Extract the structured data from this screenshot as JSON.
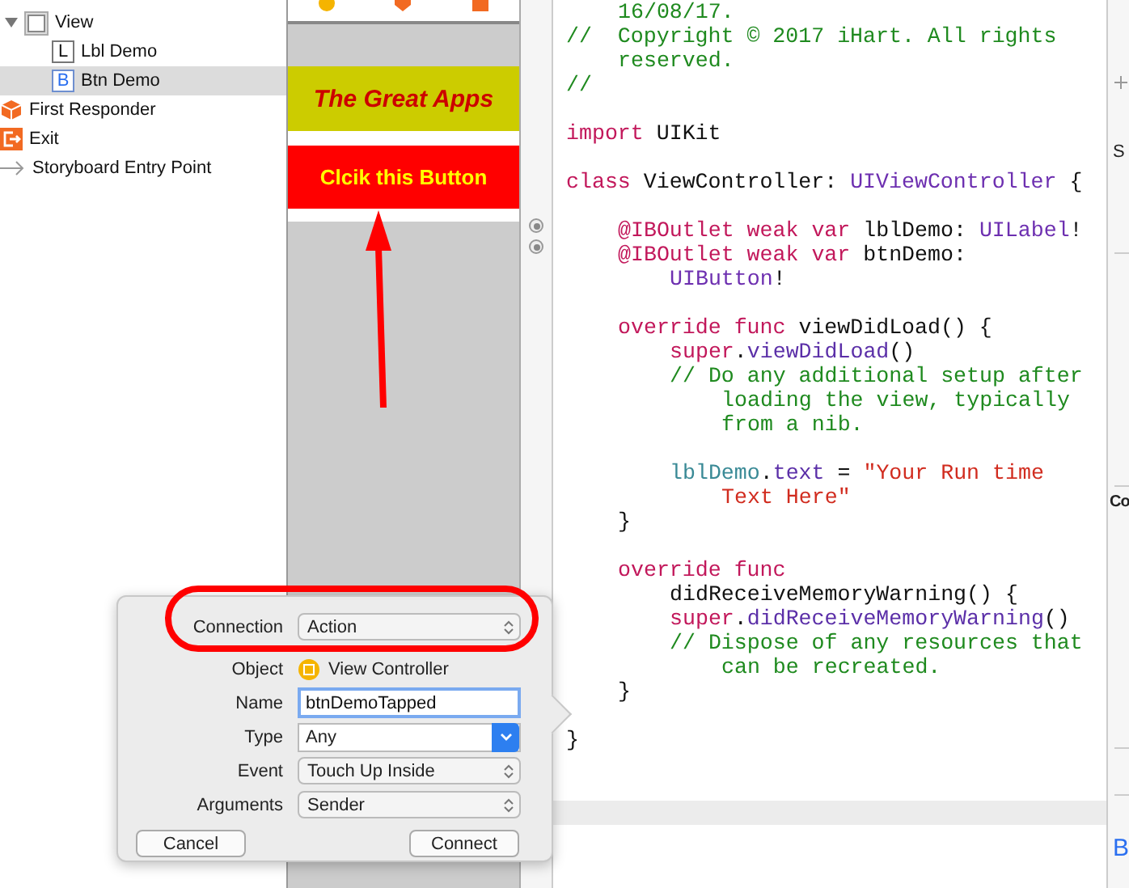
{
  "outline": {
    "items": [
      {
        "label": "View",
        "kind": "view",
        "selected": false,
        "expanded": true,
        "children": [
          {
            "label": "Lbl Demo",
            "kind": "label",
            "badge": "L",
            "selected": false
          },
          {
            "label": "Btn Demo",
            "kind": "button",
            "badge": "B",
            "selected": true
          }
        ]
      },
      {
        "label": "First Responder",
        "kind": "responder",
        "selected": false
      },
      {
        "label": "Exit",
        "kind": "exit",
        "selected": false
      },
      {
        "label": "Storyboard Entry Point",
        "kind": "entry",
        "selected": false
      }
    ]
  },
  "canvas": {
    "title_label": "The Great Apps",
    "button_label": "Clcik this Button"
  },
  "code": {
    "blocks": [
      [
        {
          "kind": "indented",
          "tokens": [
            {
              "kind": "comment",
              "text": "16/08/17."
            }
          ]
        },
        {
          "kind": "flush",
          "tokens": [
            {
              "kind": "comment",
              "text": "//  Copyright © 2017 iHart. All rights"
            }
          ]
        },
        {
          "kind": "indented",
          "tokens": [
            {
              "kind": "comment",
              "text": "reserved."
            }
          ]
        },
        {
          "kind": "flush",
          "tokens": [
            {
              "kind": "comment",
              "text": "//"
            }
          ]
        }
      ],
      [
        {
          "kind": "flush",
          "tokens": [
            {
              "kind": "keyword",
              "text": "import"
            },
            {
              "kind": "plain",
              "text": " UIKit"
            }
          ]
        }
      ],
      [
        {
          "kind": "flush",
          "tokens": [
            {
              "kind": "keyword",
              "text": "class"
            },
            {
              "kind": "plain",
              "text": " ViewController: "
            },
            {
              "kind": "type",
              "text": "UIViewController"
            },
            {
              "kind": "plain",
              "text": " {"
            }
          ]
        }
      ],
      [
        {
          "kind": "indented",
          "tokens": [
            {
              "kind": "keyword",
              "text": "@IBOutlet weak var"
            },
            {
              "kind": "plain",
              "text": " lblDemo: "
            },
            {
              "kind": "type",
              "text": "UILabel"
            },
            {
              "kind": "plain",
              "text": "!"
            }
          ]
        },
        {
          "kind": "indented",
          "tokens": [
            {
              "kind": "keyword",
              "text": "@IBOutlet weak var"
            },
            {
              "kind": "plain",
              "text": " btnDemo:"
            }
          ]
        },
        {
          "kind": "nested",
          "tokens": [
            {
              "kind": "type",
              "text": "UIButton"
            },
            {
              "kind": "plain",
              "text": "!"
            }
          ]
        }
      ],
      [
        {
          "kind": "indented",
          "tokens": [
            {
              "kind": "keyword",
              "text": "override func"
            },
            {
              "kind": "plain",
              "text": " viewDidLoad() {"
            }
          ]
        },
        {
          "kind": "nested",
          "tokens": [
            {
              "kind": "keyword",
              "text": "super"
            },
            {
              "kind": "plain",
              "text": "."
            },
            {
              "kind": "member",
              "text": "viewDidLoad"
            },
            {
              "kind": "plain",
              "text": "()"
            }
          ]
        },
        {
          "kind": "nested",
          "tokens": [
            {
              "kind": "comment",
              "text": "// Do any additional setup after"
            }
          ]
        },
        {
          "kind": "wrapped",
          "tokens": [
            {
              "kind": "comment",
              "text": "loading the view, typically"
            }
          ]
        },
        {
          "kind": "wrapped",
          "tokens": [
            {
              "kind": "comment",
              "text": "from a nib."
            }
          ]
        }
      ],
      [
        {
          "kind": "nested",
          "tokens": [
            {
              "kind": "outlet",
              "text": "lblDemo"
            },
            {
              "kind": "plain",
              "text": "."
            },
            {
              "kind": "member",
              "text": "text"
            },
            {
              "kind": "plain",
              "text": " = "
            },
            {
              "kind": "string",
              "text": "\"Your Run time"
            }
          ]
        },
        {
          "kind": "wrapped",
          "tokens": [
            {
              "kind": "string",
              "text": "Text Here\""
            }
          ]
        },
        {
          "kind": "indented",
          "tokens": [
            {
              "kind": "plain",
              "text": "}"
            }
          ]
        }
      ],
      [
        {
          "kind": "indented",
          "tokens": [
            {
              "kind": "keyword",
              "text": "override func"
            }
          ]
        },
        {
          "kind": "nested",
          "tokens": [
            {
              "kind": "plain",
              "text": "didReceiveMemoryWarning() {"
            }
          ]
        },
        {
          "kind": "nested",
          "tokens": [
            {
              "kind": "keyword",
              "text": "super"
            },
            {
              "kind": "plain",
              "text": "."
            },
            {
              "kind": "member",
              "text": "didReceiveMemoryWarning"
            },
            {
              "kind": "plain",
              "text": "()"
            }
          ]
        },
        {
          "kind": "nested",
          "tokens": [
            {
              "kind": "comment",
              "text": "// Dispose of any resources that"
            }
          ]
        },
        {
          "kind": "wrapped",
          "tokens": [
            {
              "kind": "comment",
              "text": "can be recreated."
            }
          ]
        },
        {
          "kind": "indented",
          "tokens": [
            {
              "kind": "plain",
              "text": "}"
            }
          ]
        }
      ],
      [
        {
          "kind": "flush",
          "tokens": [
            {
              "kind": "plain",
              "text": "}"
            }
          ]
        }
      ]
    ]
  },
  "inspector": {
    "texts": [
      {
        "text": "S",
        "kind": "plain"
      },
      {
        "text": "Co",
        "kind": "heading"
      },
      {
        "text": "B",
        "kind": "link"
      }
    ]
  },
  "connection_popover": {
    "rows": [
      {
        "label": "Connection",
        "kind": "popup",
        "value": "Action"
      },
      {
        "label": "Object",
        "kind": "object",
        "value": "View Controller"
      },
      {
        "label": "Name",
        "kind": "text",
        "value": "btnDemoTapped"
      },
      {
        "label": "Type",
        "kind": "combo",
        "value": "Any"
      },
      {
        "label": "Event",
        "kind": "popup",
        "value": "Touch Up Inside"
      },
      {
        "label": "Arguments",
        "kind": "popup",
        "value": "Sender"
      }
    ],
    "buttons": [
      "Cancel",
      "Connect"
    ]
  }
}
